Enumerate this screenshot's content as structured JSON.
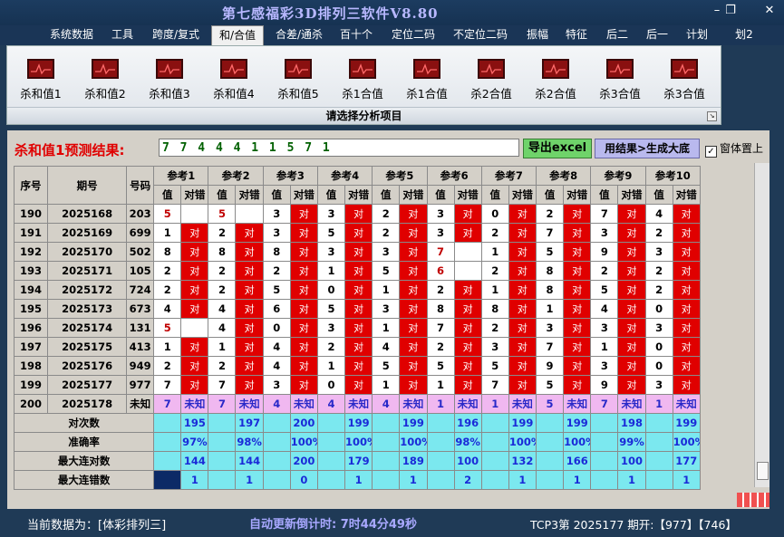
{
  "app": {
    "title": "第七感福彩3D排列三软件V8.80"
  },
  "menu": {
    "tabs": [
      "系统数据",
      "工具",
      "跨度/复式",
      "和/合值",
      "合差/通杀",
      "百十个",
      "定位二码",
      "不定位二码",
      "振幅",
      "特征",
      "后二",
      "后一",
      "计划",
      "划2"
    ],
    "active": 3
  },
  "ribbon": {
    "buttons": [
      "杀和值1",
      "杀和值2",
      "杀和值3",
      "杀和值4",
      "杀和值5",
      "杀1合值",
      "杀1合值",
      "杀2合值",
      "杀2合值",
      "杀3合值",
      "杀3合值"
    ],
    "caption": "请选择分析项目"
  },
  "prediction": {
    "label": "杀和值1预测结果:",
    "value": "7 7 4 4 4 1 1 5 7 1",
    "export_label": "导出excel",
    "generate_label": "用结果>生成大底",
    "pin_label": "窗体置上",
    "pin_checked": true
  },
  "grid": {
    "headers": {
      "seq": "序号",
      "period": "期号",
      "code": "号码",
      "value": "值",
      "result": "对错"
    },
    "refs": [
      "参考1",
      "参考2",
      "参考3",
      "参考4",
      "参考5",
      "参考6",
      "参考7",
      "参考8",
      "参考9",
      "参考10"
    ],
    "ok_text": "对",
    "rows": [
      {
        "seq": "190",
        "period": "2025168",
        "code": "203",
        "vals": [
          "5",
          "5",
          "3",
          "3",
          "2",
          "3",
          "0",
          "2",
          "7",
          "4"
        ],
        "ok": [
          0,
          0,
          1,
          1,
          1,
          1,
          1,
          1,
          1,
          1
        ]
      },
      {
        "seq": "191",
        "period": "2025169",
        "code": "699",
        "vals": [
          "1",
          "2",
          "3",
          "5",
          "2",
          "3",
          "2",
          "7",
          "3",
          "2"
        ],
        "ok": [
          1,
          1,
          1,
          1,
          1,
          1,
          1,
          1,
          1,
          1
        ]
      },
      {
        "seq": "192",
        "period": "2025170",
        "code": "502",
        "vals": [
          "8",
          "8",
          "8",
          "3",
          "3",
          "7",
          "1",
          "5",
          "9",
          "3"
        ],
        "ok": [
          1,
          1,
          1,
          1,
          1,
          0,
          1,
          1,
          1,
          1
        ]
      },
      {
        "seq": "193",
        "period": "2025171",
        "code": "105",
        "vals": [
          "2",
          "2",
          "2",
          "1",
          "5",
          "6",
          "2",
          "8",
          "2",
          "2"
        ],
        "ok": [
          1,
          1,
          1,
          1,
          1,
          0,
          1,
          1,
          1,
          1
        ]
      },
      {
        "seq": "194",
        "period": "2025172",
        "code": "724",
        "vals": [
          "2",
          "2",
          "5",
          "0",
          "1",
          "2",
          "1",
          "8",
          "5",
          "2"
        ],
        "ok": [
          1,
          1,
          1,
          1,
          1,
          1,
          1,
          1,
          1,
          1
        ]
      },
      {
        "seq": "195",
        "period": "2025173",
        "code": "673",
        "vals": [
          "4",
          "4",
          "6",
          "5",
          "3",
          "8",
          "8",
          "1",
          "4",
          "0"
        ],
        "ok": [
          1,
          1,
          1,
          1,
          1,
          1,
          1,
          1,
          1,
          1
        ]
      },
      {
        "seq": "196",
        "period": "2025174",
        "code": "131",
        "vals": [
          "5",
          "4",
          "0",
          "3",
          "1",
          "7",
          "2",
          "3",
          "3",
          "3"
        ],
        "ok": [
          0,
          1,
          1,
          1,
          1,
          1,
          1,
          1,
          1,
          1
        ]
      },
      {
        "seq": "197",
        "period": "2025175",
        "code": "413",
        "vals": [
          "1",
          "1",
          "4",
          "2",
          "4",
          "2",
          "3",
          "7",
          "1",
          "0"
        ],
        "ok": [
          1,
          1,
          1,
          1,
          1,
          1,
          1,
          1,
          1,
          1
        ]
      },
      {
        "seq": "198",
        "period": "2025176",
        "code": "949",
        "vals": [
          "2",
          "2",
          "4",
          "1",
          "5",
          "5",
          "5",
          "9",
          "3",
          "0"
        ],
        "ok": [
          1,
          1,
          1,
          1,
          1,
          1,
          1,
          1,
          1,
          1
        ]
      },
      {
        "seq": "199",
        "period": "2025177",
        "code": "977",
        "vals": [
          "7",
          "7",
          "3",
          "0",
          "1",
          "1",
          "7",
          "5",
          "9",
          "3"
        ],
        "ok": [
          1,
          1,
          1,
          1,
          1,
          1,
          1,
          1,
          1,
          1
        ]
      }
    ],
    "unknown_row": {
      "seq": "200",
      "period": "2025178",
      "code": "未知",
      "vals": [
        "7",
        "7",
        "4",
        "4",
        "4",
        "1",
        "1",
        "5",
        "7",
        "1"
      ],
      "unknown_text": "未知"
    },
    "stats": [
      {
        "label": "对次数",
        "vals": [
          "195",
          "197",
          "200",
          "199",
          "199",
          "196",
          "199",
          "199",
          "198",
          "199"
        ]
      },
      {
        "label": "准确率",
        "vals": [
          "97%",
          "98%",
          "100%",
          "100%",
          "100%",
          "98%",
          "100%",
          "100%",
          "99%",
          "100%"
        ]
      },
      {
        "label": "最大连对数",
        "vals": [
          "144",
          "144",
          "200",
          "179",
          "189",
          "100",
          "132",
          "166",
          "100",
          "177"
        ]
      },
      {
        "label": "最大连错数",
        "vals": [
          "1",
          "1",
          "0",
          "1",
          "1",
          "2",
          "1",
          "1",
          "1",
          "1"
        ]
      }
    ]
  },
  "status": {
    "current_data": "当前数据为：[体彩排列三]",
    "countdown": "自动更新倒计时:  7时44分49秒",
    "draw": "TCP3第 2025177 期开:【977】【746】"
  },
  "colors": {
    "ok_cell": "#e00000",
    "stat_cell": "#7be8ef",
    "unknown_cell": "#f0b8f0",
    "stat_text": "#1a2ad8",
    "title": "#b8b8ff"
  }
}
